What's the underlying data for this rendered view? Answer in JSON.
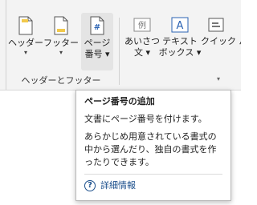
{
  "ribbon": {
    "group_header_footer": "ヘッダーとフッター",
    "buttons": {
      "header": {
        "line1": "ヘッダー",
        "caret": "▾"
      },
      "footer": {
        "line1": "フッター",
        "caret": "▾"
      },
      "page_number": {
        "line1": "ページ",
        "line2": "番号 ▾",
        "icon_glyph": "#"
      },
      "greeting": {
        "line1": "あいさつ",
        "line2": "文 ▾",
        "icon_glyph": "例"
      },
      "textbox": {
        "line1": "テキスト",
        "line2": "ボックス ▾",
        "icon_glyph": "A"
      },
      "quick_parts": {
        "line1": "クイック パー"
      }
    }
  },
  "tooltip": {
    "title": "ページ番号の追加",
    "line1": "文書にページ番号を付けます。",
    "desc": "あらかじめ用意されている書式の中から選んだり、独自の書式を作ったりできます。",
    "link": "詳細情報",
    "help_glyph": "?"
  },
  "colors": {
    "icon_blue": "#2b63b3",
    "icon_yellow": "#f2c94c",
    "link": "#1b4f8c"
  }
}
